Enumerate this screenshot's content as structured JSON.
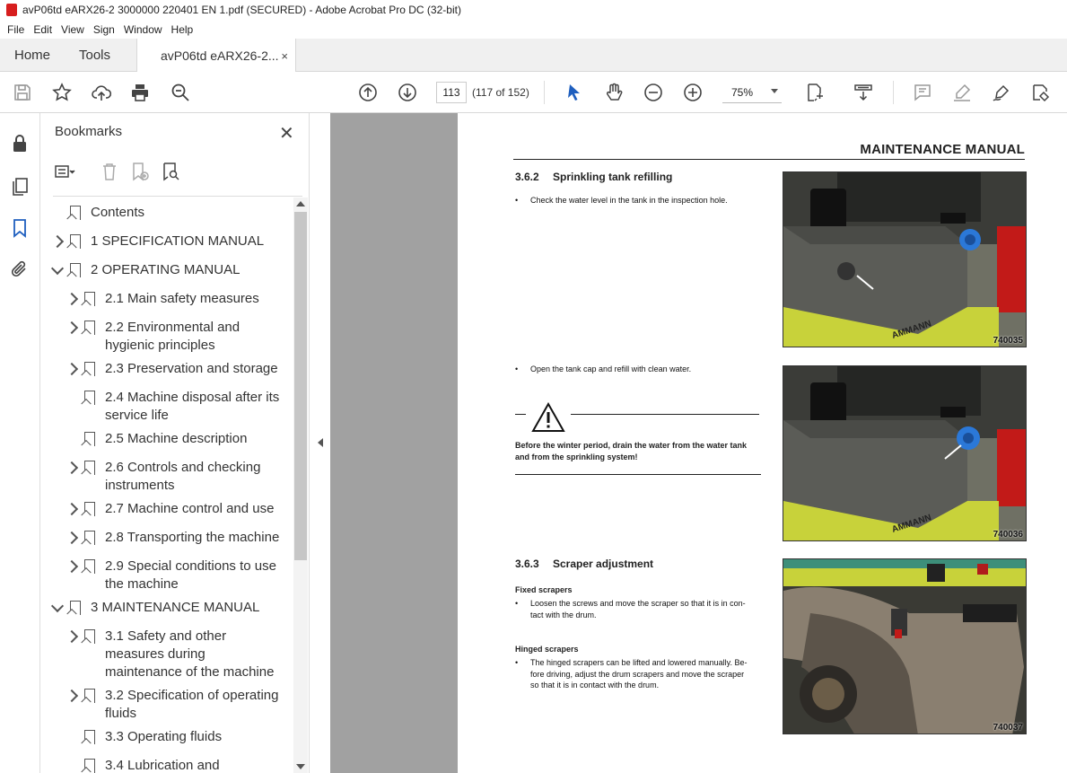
{
  "window": {
    "title": "avP06td eARX26-2 3000000 220401 EN 1.pdf (SECURED) - Adobe Acrobat Pro DC (32-bit)"
  },
  "menu": [
    "File",
    "Edit",
    "View",
    "Sign",
    "Window",
    "Help"
  ],
  "tabs": {
    "home": "Home",
    "tools": "Tools",
    "doc": "avP06td eARX26-2...",
    "close": "×"
  },
  "toolbar": {
    "page_number": "113",
    "page_count": "(117 of 152)",
    "zoom": "75%"
  },
  "bookmarks": {
    "title": "Bookmarks",
    "close": "✕",
    "items": [
      {
        "label": "Contents",
        "level": 0,
        "expander": "none"
      },
      {
        "label": "1 SPECIFICATION MANUAL",
        "level": 0,
        "expander": "right"
      },
      {
        "label": "2 OPERATING MANUAL",
        "level": 0,
        "expander": "down"
      },
      {
        "label": "2.1 Main safety measures",
        "level": 1,
        "expander": "right"
      },
      {
        "label": "2.2 Environmental and hygienic principles",
        "level": 1,
        "expander": "right"
      },
      {
        "label": "2.3 Preservation and storage",
        "level": 1,
        "expander": "right"
      },
      {
        "label": "2.4 Machine disposal after its service life",
        "level": 1,
        "expander": "none"
      },
      {
        "label": "2.5 Machine description",
        "level": 1,
        "expander": "none"
      },
      {
        "label": "2.6 Controls and checking instruments",
        "level": 1,
        "expander": "right"
      },
      {
        "label": "2.7 Machine control and use",
        "level": 1,
        "expander": "right"
      },
      {
        "label": "2.8 Transporting the machine",
        "level": 1,
        "expander": "right"
      },
      {
        "label": "2.9 Special conditions to use the machine",
        "level": 1,
        "expander": "right"
      },
      {
        "label": "3 MAINTENANCE MANUAL",
        "level": 0,
        "expander": "down"
      },
      {
        "label": "3.1 Safety and other measures during maintenance of the machine",
        "level": 1,
        "expander": "right"
      },
      {
        "label": "3.2 Specification of operating fluids",
        "level": 1,
        "expander": "right"
      },
      {
        "label": "3.3 Operating fluids",
        "level": 1,
        "expander": "none"
      },
      {
        "label": "3.4 Lubrication and",
        "level": 1,
        "expander": "none"
      }
    ]
  },
  "page": {
    "header": "MAINTENANCE MANUAL",
    "s1": {
      "num": "3.6.2",
      "title": "Sprinkling tank refilling"
    },
    "bullet": "•",
    "b1": "Check the water level in the tank in the inspection hole.",
    "b2": "Open the tank cap and refill with clean water.",
    "warning": "Before the winter period, drain the water from the water tank and from the sprinkling system!",
    "s2": {
      "num": "3.6.3",
      "title": "Scraper adjustment"
    },
    "fixed_title": "Fixed scrapers",
    "fixed_l1": "Loosen the screws and move the scraper so that it is in con-",
    "fixed_l2": "tact with the drum.",
    "hinged_title": "Hinged scrapers",
    "hinged_l1": "The hinged scrapers can be lifted and lowered manually. Be-",
    "hinged_l2": "fore driving, adjust the drum scrapers and move the scraper",
    "hinged_l3": "so that it is in contact with the drum.",
    "photos": [
      "740035",
      "740036",
      "740037"
    ],
    "brand": "AMMANN"
  }
}
